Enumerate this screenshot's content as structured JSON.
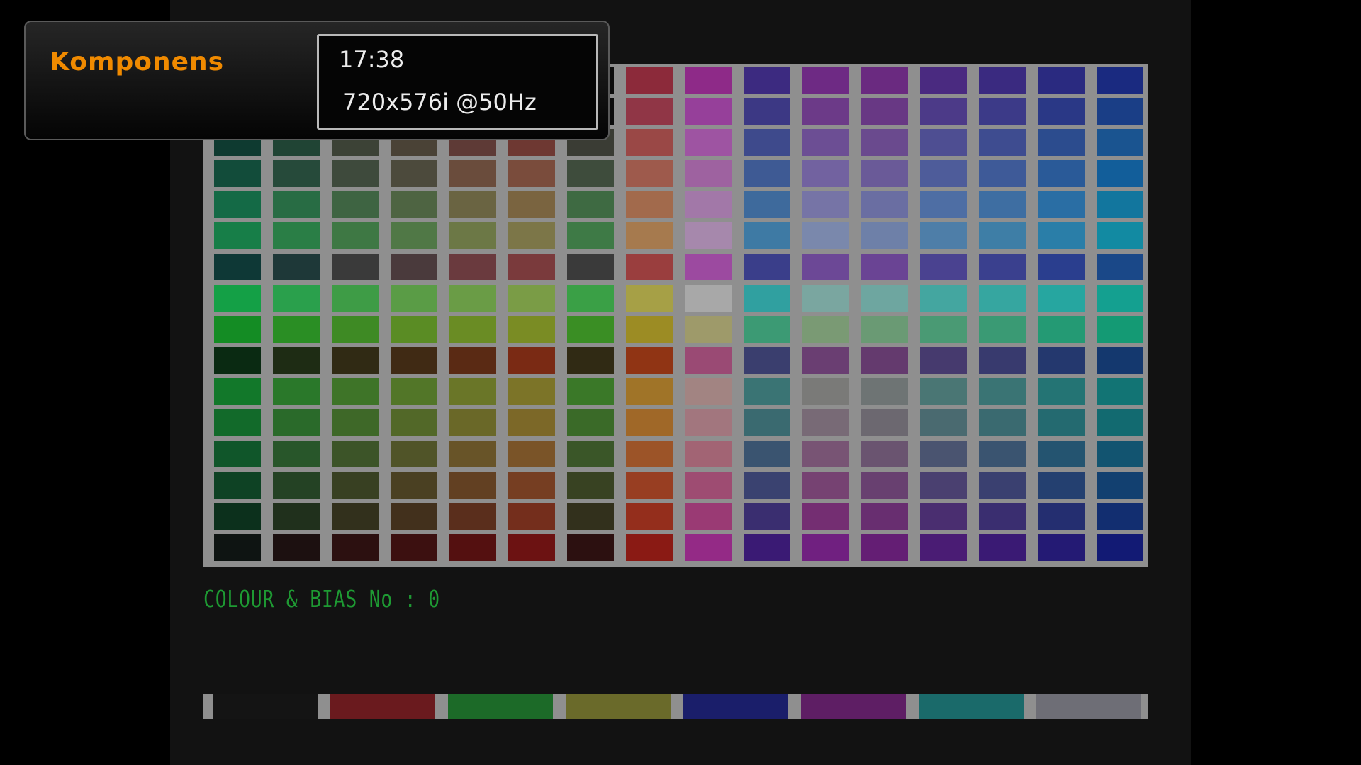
{
  "osd": {
    "channel_name": "Komponens",
    "time": "17:38",
    "resolution": "720x576i @50Hz"
  },
  "test_pattern": {
    "label": "COLOUR & BIAS No : 0",
    "label_color": "#1e9a33",
    "grid_line_color": "#8f8f8f",
    "background_color": "#121212",
    "palette_rows": [
      [
        "#080c0e",
        "#0c0c0e",
        "#0c0c0c",
        "#0e0c0c",
        "#0c0c0c",
        "#0c0c0c",
        "#0c0c0c",
        "#8c2a3a",
        "#8e2a88",
        "#3c2a80",
        "#6e2a84",
        "#6a2a80",
        "#4a2a80",
        "#3a2a80",
        "#2a2a80",
        "#1a2a80"
      ],
      [
        "#0a1214",
        "#0c0e10",
        "#0c0c0e",
        "#0e0c0e",
        "#0e0c0c",
        "#0e0c0c",
        "#0c0c0c",
        "#903646",
        "#96409a",
        "#3c3884",
        "#6c3a88",
        "#683884",
        "#4c3a88",
        "#3c3a88",
        "#2a3886",
        "#1a3e86"
      ],
      [
        "#0e3a30",
        "#204434",
        "#3c4236",
        "#4a4236",
        "#5e3a36",
        "#6e3832",
        "#3a3c34",
        "#9a4846",
        "#9e54a2",
        "#3e4a8c",
        "#6c4e94",
        "#6a4a8e",
        "#4e4e92",
        "#3e4c90",
        "#2c4c8e",
        "#1a5490"
      ],
      [
        "#124c3a",
        "#264a3a",
        "#3e4a3c",
        "#4c4a3c",
        "#6a4c3c",
        "#7a4c3c",
        "#3e4c3c",
        "#9e5a4c",
        "#9e62a0",
        "#3e5a94",
        "#7262a0",
        "#6a5a98",
        "#4e5c9a",
        "#3e5a98",
        "#2a5a98",
        "#125e9a"
      ],
      [
        "#146a46",
        "#286c44",
        "#3e6442",
        "#4e6442",
        "#6a6442",
        "#7a6440",
        "#3e6a42",
        "#a26a4c",
        "#a278a8",
        "#3e6a9c",
        "#7674a6",
        "#6a6ea2",
        "#4e6ea4",
        "#3e6ea2",
        "#2a6ea4",
        "#12769e"
      ],
      [
        "#177e48",
        "#2a7e46",
        "#3e7844",
        "#507846",
        "#6c7846",
        "#7c7648",
        "#3e7a46",
        "#a67a4e",
        "#a688ac",
        "#3e7aa4",
        "#7a88ac",
        "#6e80a8",
        "#4e7ea8",
        "#3e7ea6",
        "#2a7ea8",
        "#128aa2"
      ],
      [
        "#0e3836",
        "#1e3838",
        "#3a3a3a",
        "#4a3a3c",
        "#6a3a3e",
        "#7a3a3c",
        "#3a3a3a",
        "#9a3e3e",
        "#9c4aa0",
        "#3a3e8a",
        "#6c4896",
        "#6a4494",
        "#4a4290",
        "#3a408e",
        "#2a3e8e",
        "#1a4888"
      ],
      [
        "#14a046",
        "#2aa04c",
        "#3e9c46",
        "#5a9c46",
        "#6a9c46",
        "#7a9c46",
        "#3aa046",
        "#a6a046",
        "#a8a8a8",
        "#30a0a0",
        "#7aa6a0",
        "#6ea6a0",
        "#44a6a0",
        "#36a6a0",
        "#26a6a0",
        "#14a090"
      ],
      [
        "#148c24",
        "#2a8e24",
        "#3e8a24",
        "#5a8c24",
        "#6a8c24",
        "#7a8c24",
        "#3a8e24",
        "#9c8c24",
        "#9e9a6a",
        "#3c9a74",
        "#7a9a74",
        "#6a9a74",
        "#4a9a74",
        "#3a9a74",
        "#249a74",
        "#149a74"
      ],
      [
        "#0a2a12",
        "#1e2c14",
        "#302a14",
        "#402a14",
        "#5a2a14",
        "#7a2a14",
        "#302a14",
        "#903414",
        "#9a4a74",
        "#3a3e6e",
        "#6a3e72",
        "#643a6e",
        "#463a6e",
        "#383a6e",
        "#24386e",
        "#14386e"
      ],
      [
        "#12782a",
        "#2a782a",
        "#3e7428",
        "#527628",
        "#6a7628",
        "#7c7428",
        "#3a7828",
        "#a07428",
        "#a28482",
        "#3a7474",
        "#7a7a78",
        "#6e7474",
        "#4a7674",
        "#3a7474",
        "#247474",
        "#127474"
      ],
      [
        "#126a2a",
        "#2a6a2a",
        "#3e6828",
        "#526828",
        "#6a6828",
        "#7c6828",
        "#3a6a28",
        "#a06828",
        "#a2767e",
        "#3a6a70",
        "#786a76",
        "#6c6870",
        "#4a6a70",
        "#3a6a70",
        "#246a70",
        "#126a70"
      ],
      [
        "#10562a",
        "#28562a",
        "#3c5428",
        "#505428",
        "#685428",
        "#7a5428",
        "#3a5628",
        "#9c5428",
        "#a26474",
        "#3a5470",
        "#785474",
        "#6a5470",
        "#4a5470",
        "#3a5470",
        "#245470",
        "#125470"
      ],
      [
        "#0e4224",
        "#244224",
        "#384022",
        "#4a4022",
        "#624022",
        "#763e22",
        "#384222",
        "#983e22",
        "#9e4c72",
        "#3a4270",
        "#764272",
        "#684070",
        "#4a4070",
        "#3a4070",
        "#244070",
        "#124070"
      ],
      [
        "#0c301c",
        "#20301c",
        "#32301c",
        "#42301c",
        "#5a2e1c",
        "#742e1c",
        "#32301c",
        "#942e1c",
        "#9a3a74",
        "#3a2e70",
        "#742e72",
        "#682e70",
        "#4a2e70",
        "#3a2e70",
        "#242e70",
        "#122e70"
      ],
      [
        "#0e1412",
        "#1c1010",
        "#2c1010",
        "#3c1010",
        "#541010",
        "#6c1212",
        "#2c1010",
        "#8a1a14",
        "#942a86",
        "#3a1a74",
        "#702080",
        "#641e74",
        "#4a1c74",
        "#3a1a74",
        "#241a74",
        "#121a74"
      ]
    ],
    "bias_colors": [
      "#141414",
      "#6a1a1e",
      "#1c6a28",
      "#6a6a2a",
      "#1a1e6a",
      "#5e1e64",
      "#1a6a6a",
      "#6e6e76"
    ]
  }
}
